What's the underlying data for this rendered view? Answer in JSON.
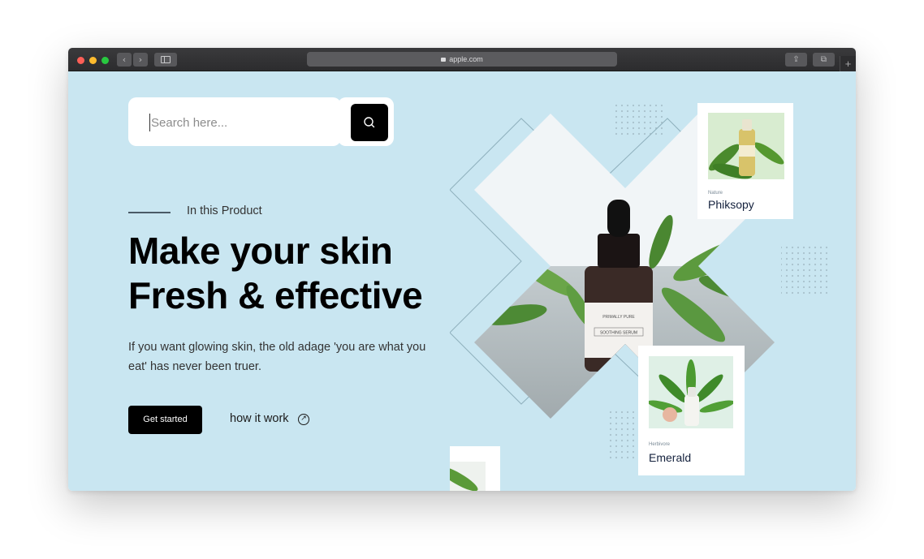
{
  "browser": {
    "url": "apple.com",
    "nav_back": "‹",
    "nav_forward": "›",
    "share_icon": "⇪",
    "tabs_icon": "⧉",
    "new_tab": "+"
  },
  "search": {
    "placeholder": "Search here..."
  },
  "hero": {
    "eyebrow": "In this Product",
    "headline_line1": "Make your skin",
    "headline_line2": "Fresh & effective",
    "description": "If you want glowing skin, the old adage 'you are what you eat' has never been truer.",
    "cta_label": "Get started",
    "secondary_label": "how it work",
    "secondary_icon": "↗",
    "bottle_brand": "PRIMALLY PURE",
    "bottle_label": "SOOTHING SERUM"
  },
  "products": [
    {
      "category": "Nature",
      "name": "Phiksopy"
    },
    {
      "category": "Herbivore",
      "name": "Emerald"
    }
  ],
  "colors": {
    "page_bg": "#c9e6f1",
    "button_bg": "#000000",
    "card_bg": "#ffffff",
    "title_text": "#14213d"
  }
}
